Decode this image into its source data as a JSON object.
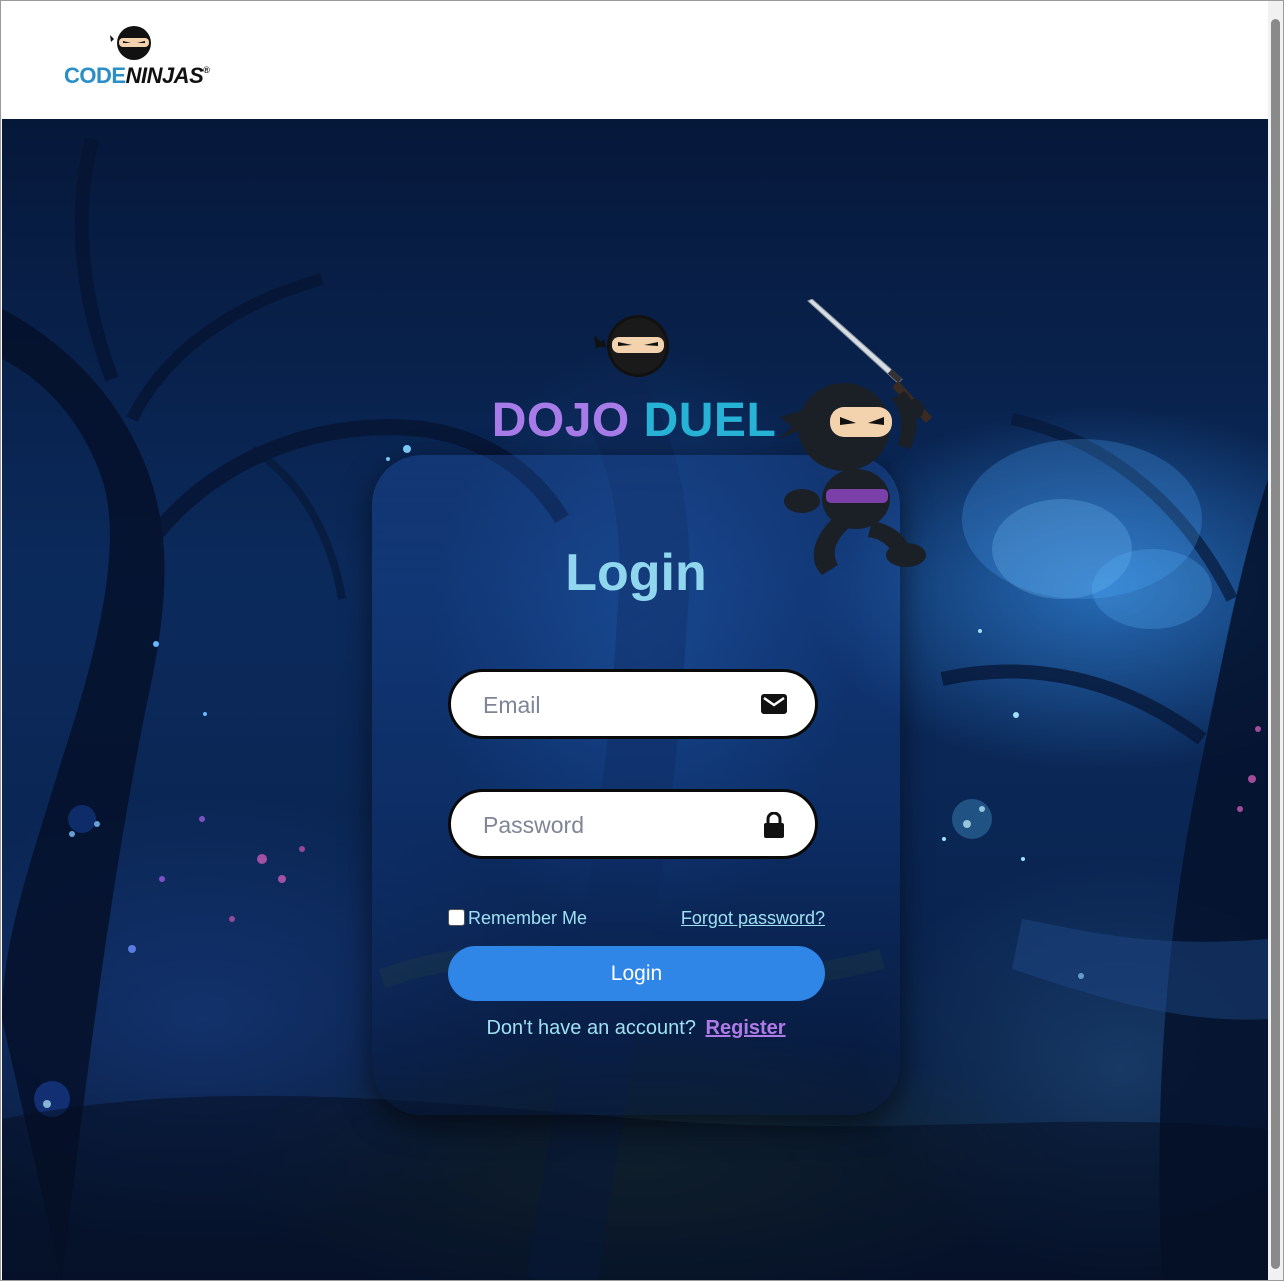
{
  "header": {
    "logo_part1": "CODE",
    "logo_part2": "NINJAS",
    "logo_mark": "®",
    "logo_icon": "ninja-head-icon"
  },
  "hero": {
    "title_part1": "DOJO",
    "title_part2": "DUEL",
    "title_icon": "ninja-head-icon"
  },
  "login": {
    "heading": "Login",
    "email": {
      "value": "",
      "placeholder": "Email",
      "icon": "envelope-icon"
    },
    "password": {
      "value": "",
      "placeholder": "Password",
      "icon": "lock-icon"
    },
    "remember_label": "Remember Me",
    "remember_checked": false,
    "forgot_label": "Forgot password?",
    "submit_label": "Login",
    "signup_prompt": "Don't have an account?",
    "register_label": "Register"
  },
  "colors": {
    "title_purple": "#a77be8",
    "title_teal": "#27b3d6",
    "heading_cyan": "#8fd6ee",
    "button_blue": "#2f86e6",
    "register_purple": "#b07be8"
  }
}
